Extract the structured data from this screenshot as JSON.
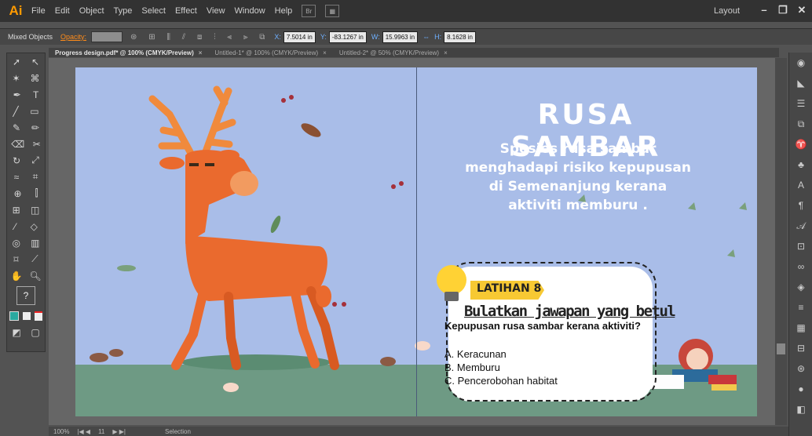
{
  "app": {
    "logo": "Ai",
    "workspace": "Layout"
  },
  "menu": [
    "File",
    "Edit",
    "Object",
    "Type",
    "Select",
    "Effect",
    "View",
    "Window",
    "Help"
  ],
  "control": {
    "selection_label": "Mixed Objects",
    "opacity_label": "Opacity:",
    "x_label": "X:",
    "x_value": "7.5014 in",
    "y_label": "Y:",
    "y_value": "-83.1267 in",
    "w_label": "W:",
    "w_value": "15.9963 in",
    "h_label": "H:",
    "h_value": "8.1628 in"
  },
  "tabs": [
    {
      "label": "Progress design.pdf* @ 100% (CMYK/Preview)",
      "active": true
    },
    {
      "label": "Untitled-1* @ 100% (CMYK/Preview)",
      "active": false
    },
    {
      "label": "Untitled-2* @ 50% (CMYK/Preview)",
      "active": false
    }
  ],
  "status": {
    "zoom": "100%",
    "page": "11",
    "tool": "Selection"
  },
  "artwork": {
    "title": "RUSA SAMBAR",
    "description": "Spesies rusa sambar menghadapi risiko kepupusan di Semenanjung kerana aktiviti memburu .",
    "exercise_label": "LATIHAN 8",
    "instruction": "Bulatkan jawapan yang betul",
    "question": "Kepupusan rusa sambar  kerana aktiviti?",
    "options": [
      "A. Keracunan",
      "B. Memburu",
      "C. Pencerobohan habitat"
    ]
  },
  "colors": {
    "accent": "#ff9a00",
    "artboard_bg": "#a9bde8",
    "ground": "#6e9a84",
    "deer": "#ea6a2e",
    "badge": "#f7c933"
  }
}
